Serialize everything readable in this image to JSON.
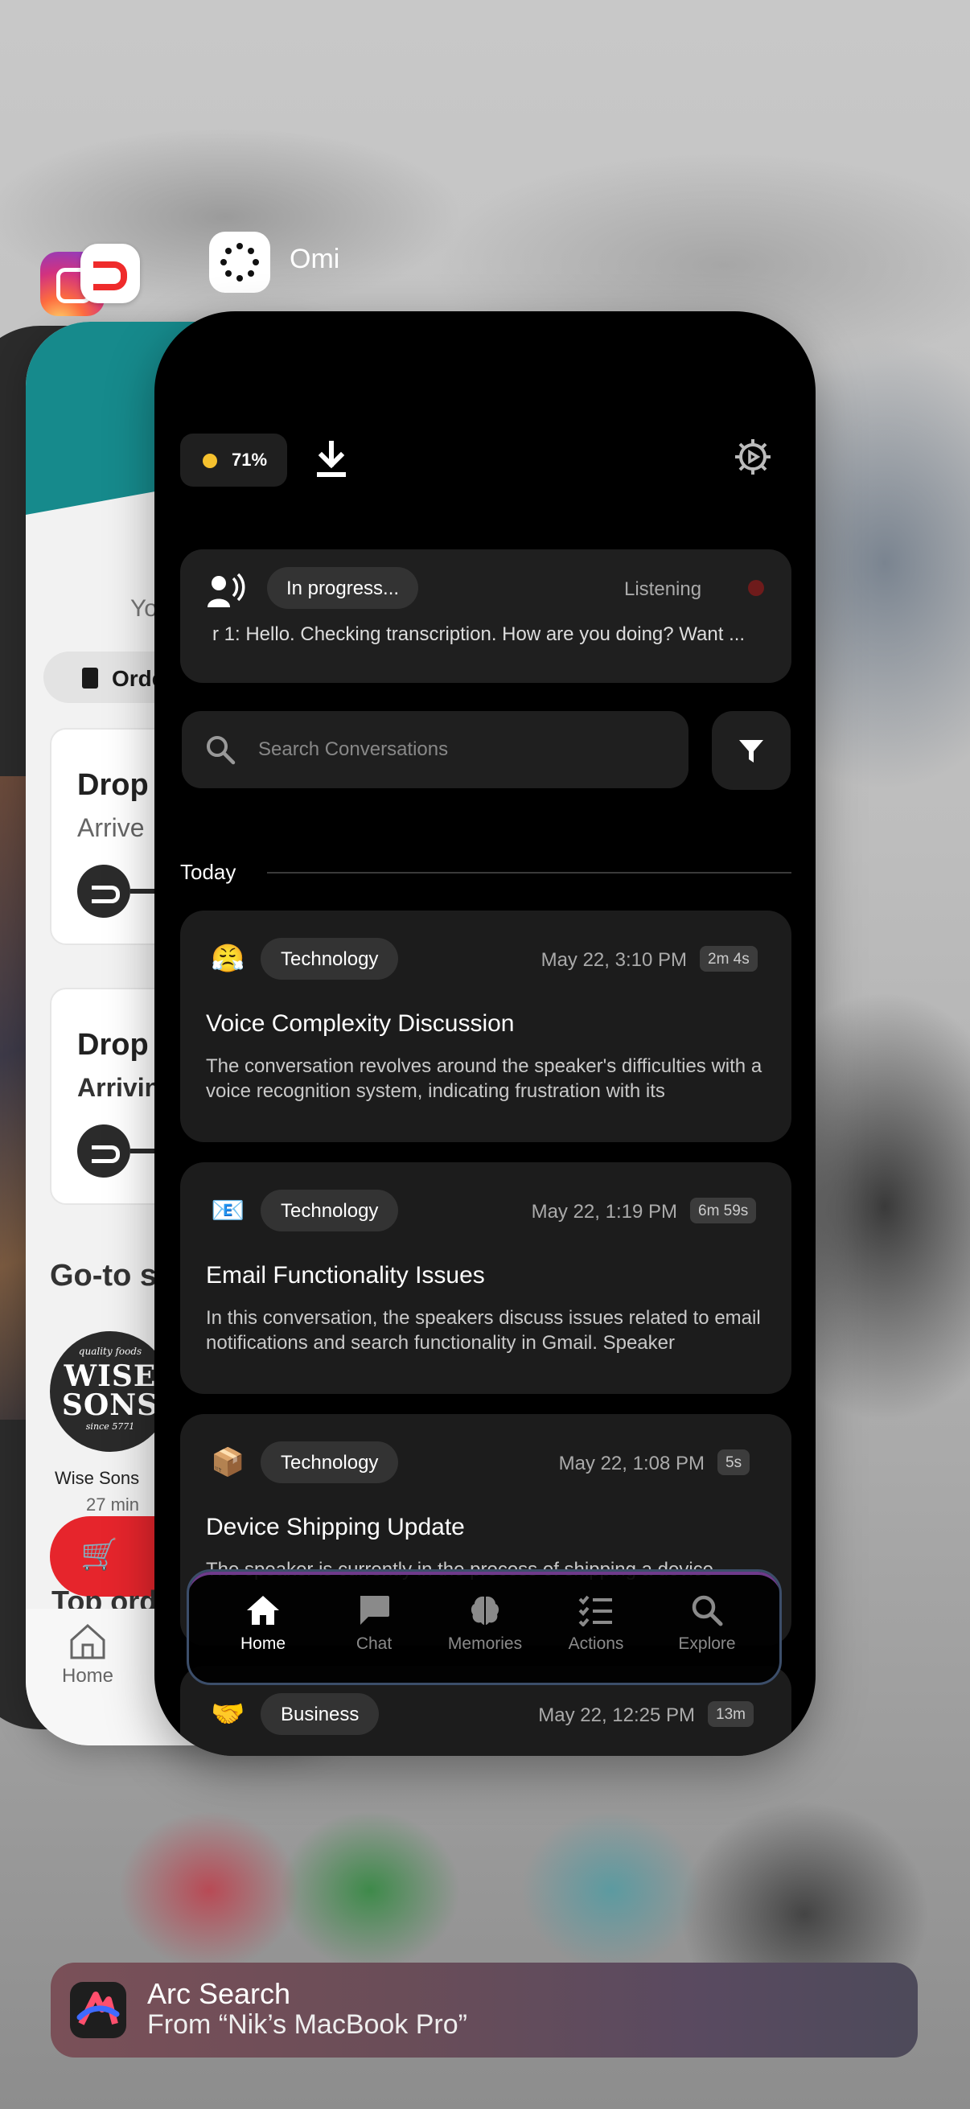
{
  "switcher": {
    "app_label": "Omi"
  },
  "background_cards": {
    "doordash": {
      "you": "Yo",
      "orders_chip": "Orde",
      "box1_title": "Drop",
      "box1_sub": "Arrive",
      "box2_title": "Drop",
      "box2_sub": "Arrivin",
      "goto": "Go-to s",
      "wise_small": "quality foods",
      "wise_big": "WISE SONS",
      "wise_since": "since 5771",
      "wise_name": "Wise Sons",
      "wise_time": "27 min",
      "top_orders": "Top ord",
      "home_label": "Home"
    }
  },
  "omi": {
    "battery": "71%",
    "status": {
      "label": "In progress...",
      "listening": "Listening",
      "transcript": "r 1: Hello. Checking transcription. How are you doing? Want ..."
    },
    "search": {
      "placeholder": "Search Conversations"
    },
    "section": "Today",
    "conversations": [
      {
        "emoji": "😤",
        "category": "Technology",
        "date": "May 22, 3:10 PM",
        "duration": "2m 4s",
        "title": "Voice Complexity Discussion",
        "description": "The conversation revolves around the speaker's difficulties with a voice recognition system, indicating frustration with its"
      },
      {
        "emoji": "📧",
        "category": "Technology",
        "date": "May 22, 1:19 PM",
        "duration": "6m 59s",
        "title": "Email Functionality Issues",
        "description": "In this conversation, the speakers discuss issues related to email notifications and search functionality in Gmail. Speaker"
      },
      {
        "emoji": "📦",
        "category": "Technology",
        "date": "May 22, 1:08 PM",
        "duration": "5s",
        "title": "Device Shipping Update",
        "description": "The speaker is currently in the process of shipping a device"
      },
      {
        "emoji": "🤝",
        "category": "Business",
        "date": "May 22, 12:25 PM",
        "duration": "13m"
      }
    ],
    "tabs": {
      "home": "Home",
      "chat": "Chat",
      "memories": "Memories",
      "actions": "Actions",
      "explore": "Explore"
    }
  },
  "handoff": {
    "app": "Arc Search",
    "source": "From “Nik’s MacBook Pro”"
  },
  "colors": {
    "battery_dot": "#f5c12e",
    "recording_dot": "#6e1b1b",
    "doordash_red": "#ef2b2b",
    "doordash_teal": "#168a8c"
  }
}
